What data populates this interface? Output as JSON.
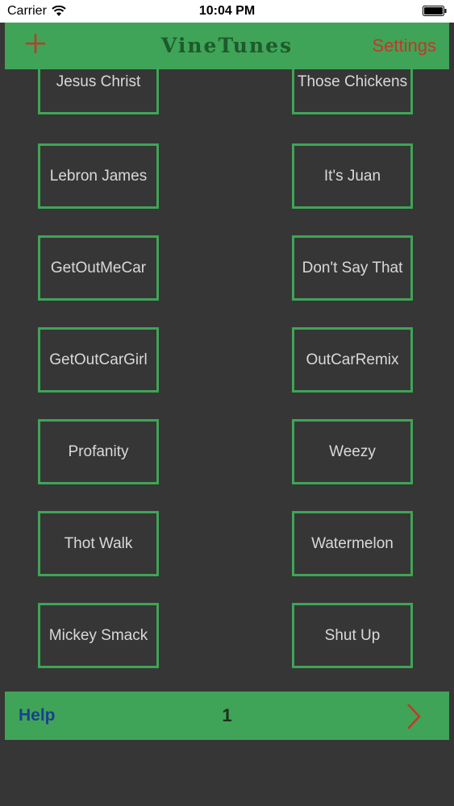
{
  "status_bar": {
    "carrier": "Carrier",
    "time": "10:04 PM",
    "icons": [
      "wifi-icon",
      "battery-icon"
    ]
  },
  "navbar": {
    "add_icon": "plus-icon",
    "title": "VineTunes",
    "settings_label": "Settings"
  },
  "tiles": [
    {
      "label": "Jesus Christ"
    },
    {
      "label": "Those Chickens"
    },
    {
      "label": "Lebron James"
    },
    {
      "label": "It's Juan"
    },
    {
      "label": "GetOutMeCar"
    },
    {
      "label": "Don't Say That"
    },
    {
      "label": "GetOutCarGirl"
    },
    {
      "label": "OutCarRemix"
    },
    {
      "label": "Profanity"
    },
    {
      "label": "Weezy"
    },
    {
      "label": "Thot Walk"
    },
    {
      "label": "Watermelon"
    },
    {
      "label": "Mickey Smack"
    },
    {
      "label": "Shut Up"
    }
  ],
  "bottom_bar": {
    "help_label": "Help",
    "page_number": "1",
    "next_icon": "chevron-right-icon"
  },
  "colors": {
    "background": "#363636",
    "accent_green": "#3fa457",
    "title_green": "#1e5a2c",
    "settings_red": "#c0392b",
    "help_blue": "#1a3f8f",
    "tile_text": "#d9d9d9"
  }
}
